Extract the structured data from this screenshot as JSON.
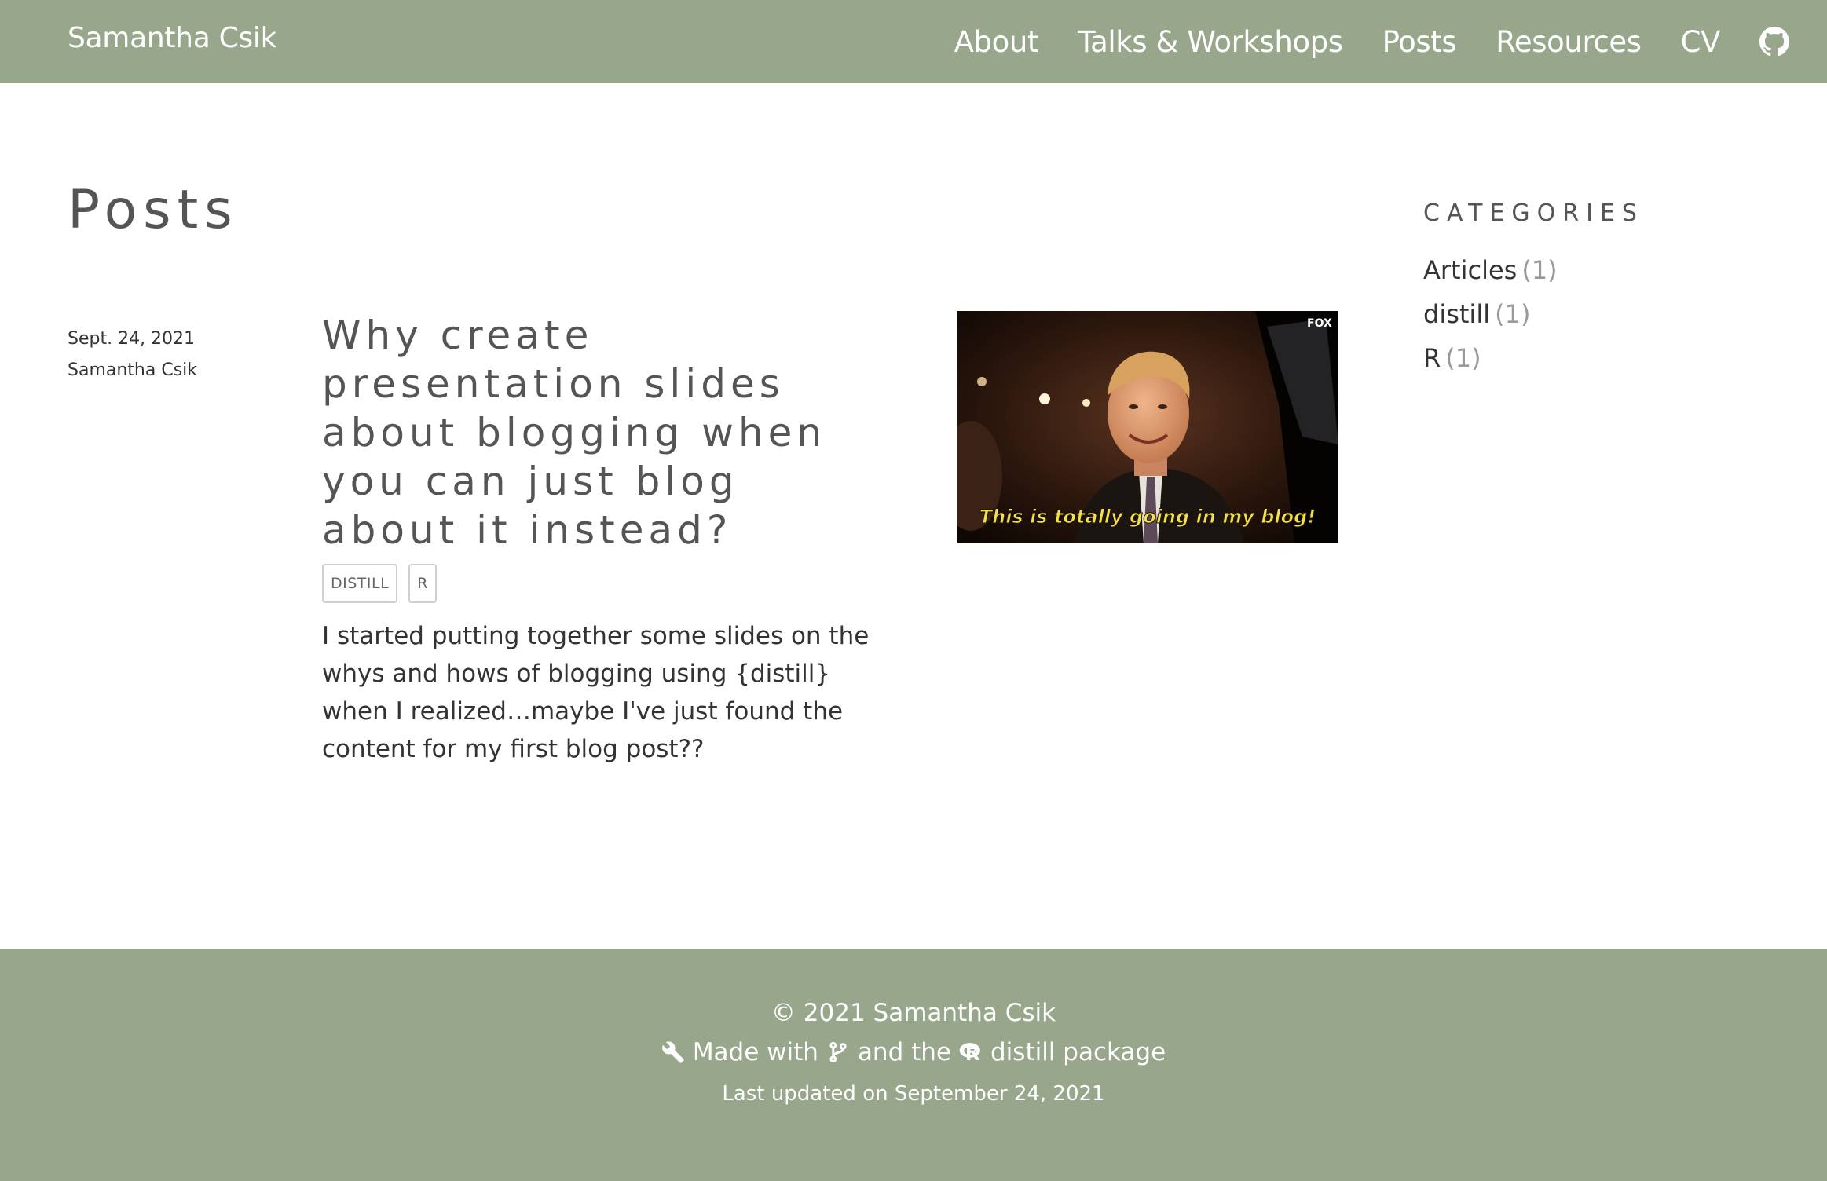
{
  "header": {
    "site_title": "Samantha Csik",
    "nav": [
      "About",
      "Talks & Workshops",
      "Posts",
      "Resources",
      "CV"
    ],
    "github_icon": "github-icon"
  },
  "main": {
    "heading": "Posts",
    "posts": [
      {
        "date": "Sept. 24, 2021",
        "author": "Samantha Csik",
        "title": "Why create presentation slides about blogging when you can just blog about it instead?",
        "tags": [
          "DISTILL",
          "R"
        ],
        "description": "I started putting together some slides on the whys and hows of blogging using {distill} when I realized…maybe I've just found the content for my first blog post??",
        "thumbnail_caption": "This is totally going in my blog!",
        "thumbnail_logo": "FOX"
      }
    ]
  },
  "sidebar": {
    "heading": "CATEGORIES",
    "categories": [
      {
        "name": "Articles",
        "count": "(1)"
      },
      {
        "name": "distill",
        "count": "(1)"
      },
      {
        "name": "R",
        "count": "(1)"
      }
    ]
  },
  "footer": {
    "copyright": "© 2021 Samantha Csik",
    "made_with": "Made with",
    "and_the": "and the",
    "package": "distill package",
    "updated": "Last updated on September 24, 2021",
    "icons": [
      "wrench-icon",
      "git-branch-icon",
      "r-logo-icon"
    ]
  },
  "colors": {
    "header_bg": "#98a68c",
    "footer_bg": "#98a68c",
    "heading_text": "#555555",
    "body_text": "#333333"
  }
}
